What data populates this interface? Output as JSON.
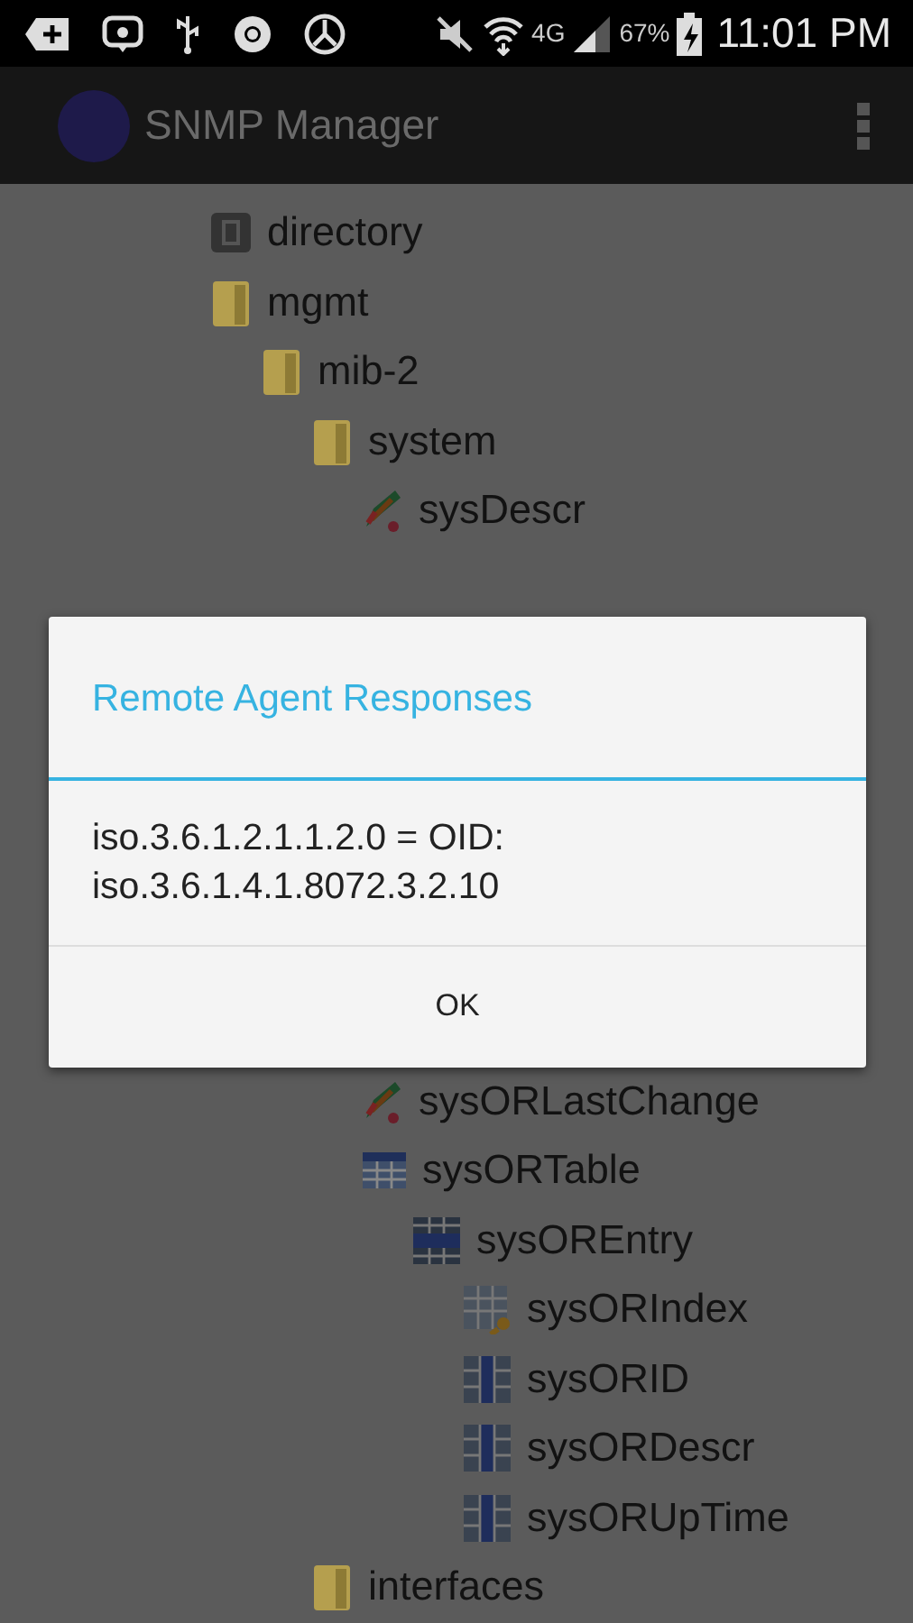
{
  "status_bar": {
    "network": "4G",
    "battery": "67%",
    "time": "11:01 PM"
  },
  "app_bar": {
    "title": "SNMP Manager"
  },
  "tree": [
    {
      "label": "directory",
      "kind": "directory"
    },
    {
      "label": "mgmt",
      "kind": "folder",
      "children": [
        {
          "label": "mib-2",
          "kind": "folder",
          "children": [
            {
              "label": "system",
              "kind": "folder",
              "children": [
                {
                  "label": "sysDescr",
                  "kind": "scalar"
                },
                {
                  "label": "sysORLastChange",
                  "kind": "scalar"
                },
                {
                  "label": "sysORTable",
                  "kind": "table",
                  "children": [
                    {
                      "label": "sysOREntry",
                      "kind": "entry",
                      "children": [
                        {
                          "label": "sysORIndex",
                          "kind": "index"
                        },
                        {
                          "label": "sysORID",
                          "kind": "column"
                        },
                        {
                          "label": "sysORDescr",
                          "kind": "column"
                        },
                        {
                          "label": "sysORUpTime",
                          "kind": "column"
                        }
                      ]
                    }
                  ]
                }
              ]
            },
            {
              "label": "interfaces",
              "kind": "folder"
            }
          ]
        }
      ]
    }
  ],
  "dialog": {
    "title": "Remote Agent Responses",
    "message": "iso.3.6.1.2.1.1.2.0 = OID: iso.3.6.1.4.1.8072.3.2.10",
    "buttons": [
      "OK"
    ]
  }
}
